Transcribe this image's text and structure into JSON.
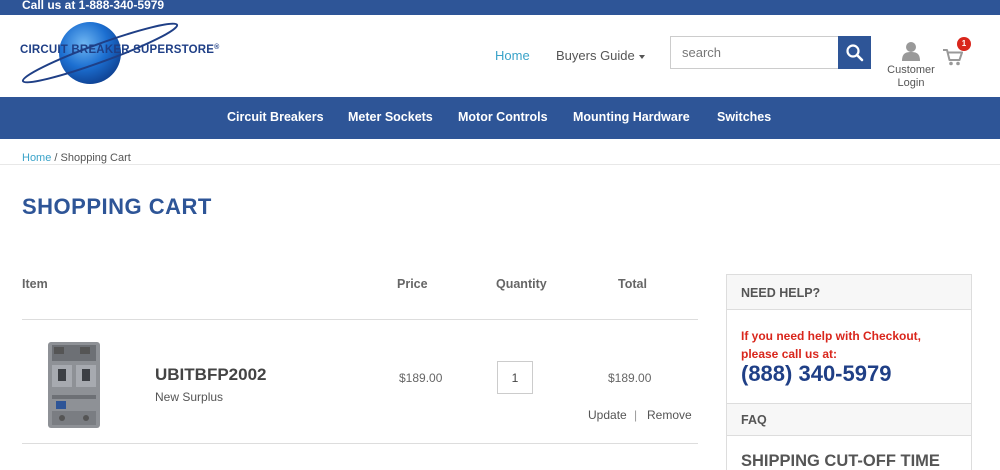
{
  "topbar": {
    "phone_text": "Call us at 1-888-340-5979"
  },
  "logo": {
    "text": "CIRCUIT BREAKER SUPERSTORE",
    "registered": "®"
  },
  "header_nav": {
    "home": "Home",
    "buyers_guide": "Buyers Guide"
  },
  "search": {
    "placeholder": "search"
  },
  "account": {
    "label_line1": "Customer",
    "label_line2": "Login"
  },
  "cart": {
    "count": "1"
  },
  "categories": [
    "Circuit Breakers",
    "Meter Sockets",
    "Motor Controls",
    "Mounting Hardware",
    "Switches"
  ],
  "breadcrumb": {
    "home": "Home",
    "separator": " / ",
    "current": "Shopping Cart"
  },
  "page_title": "SHOPPING CART",
  "table_headers": {
    "item": "Item",
    "price": "Price",
    "quantity": "Quantity",
    "total": "Total"
  },
  "cart_item": {
    "sku": "UBITBFP2002",
    "condition": "New Surplus",
    "price": "$189.00",
    "quantity": "1",
    "total": "$189.00",
    "update": "Update",
    "separator": "|",
    "remove": "Remove"
  },
  "help": {
    "heading": "NEED HELP?",
    "message": "If you need help with Checkout, please call us at:",
    "phone": "(888) 340-5979",
    "faq_heading": "FAQ",
    "cutoff_heading": "SHIPPING CUT-OFF TIME"
  },
  "colors": {
    "brand_blue": "#2e5597",
    "link_teal": "#3aa3c9",
    "alert_red": "#d9261c"
  }
}
